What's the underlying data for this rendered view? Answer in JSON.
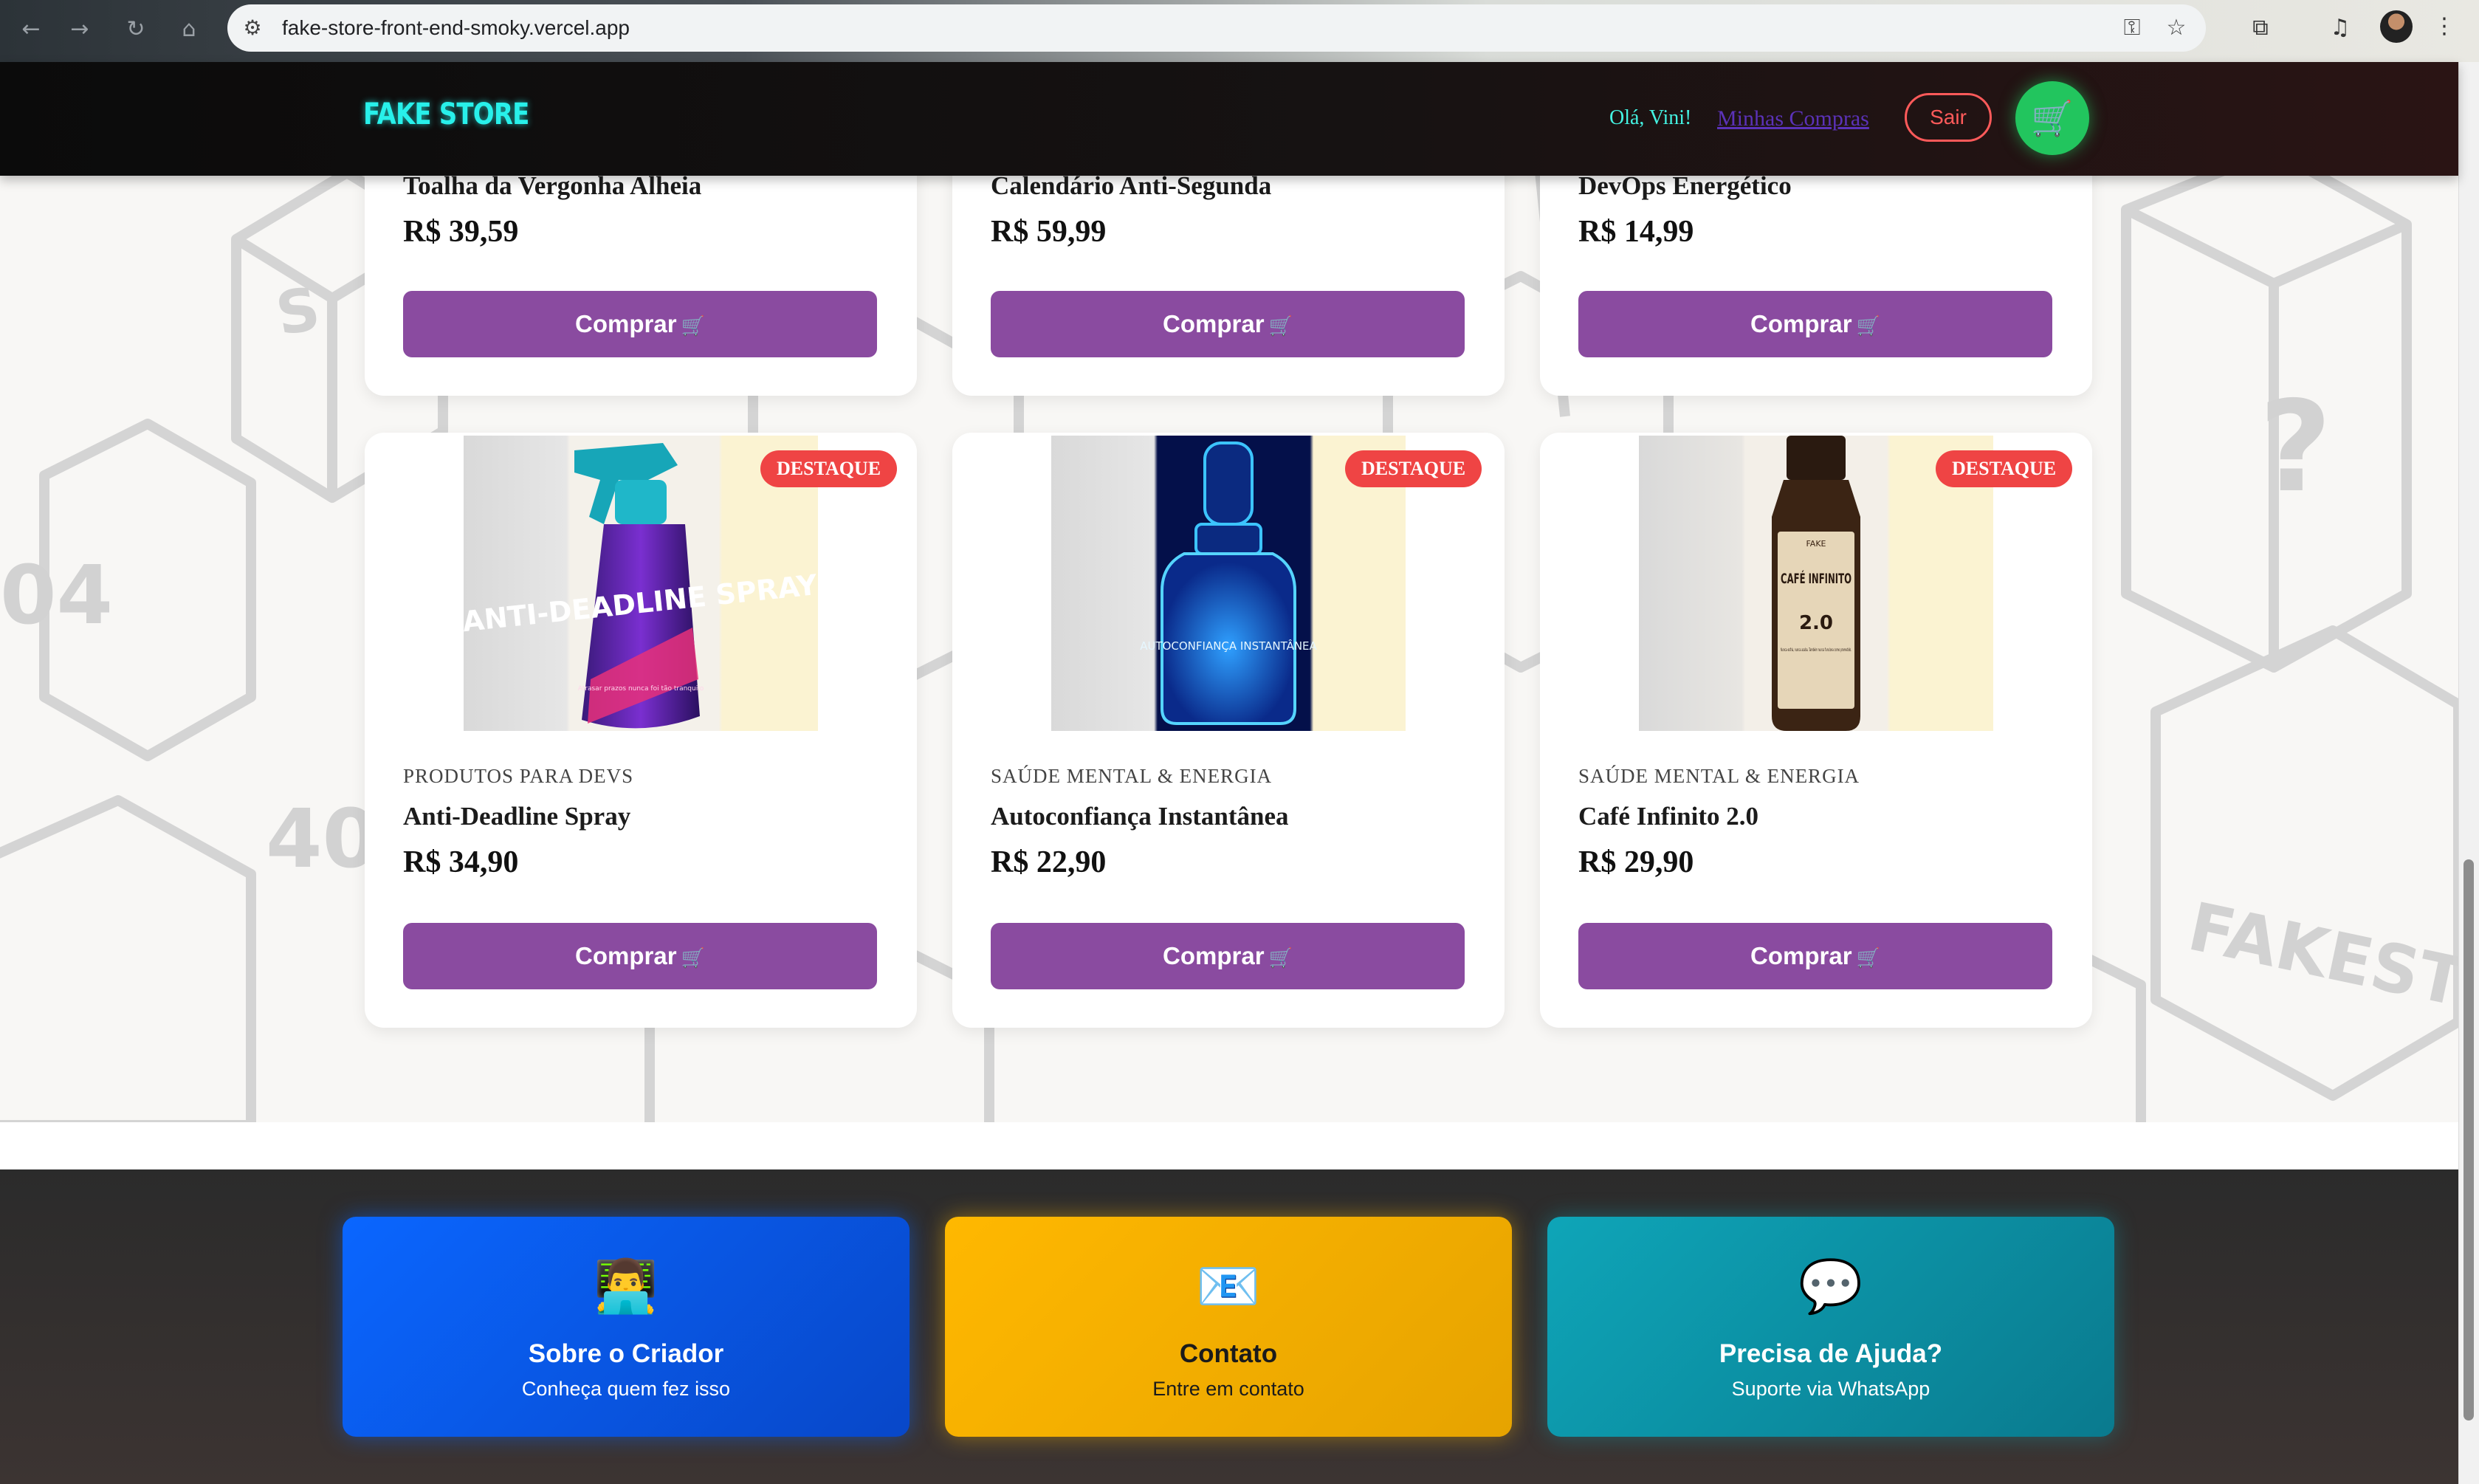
{
  "browser": {
    "url": "fake-store-front-end-smoky.vercel.app"
  },
  "header": {
    "logo": "FAKE STORE",
    "greeting": "Olá, Vini!",
    "orders_link": "Minhas Compras",
    "logout": "Sair"
  },
  "top_row": [
    {
      "name": "Toalha da Vergonha Alheia",
      "price": "R$ 39,59",
      "button": "Comprar"
    },
    {
      "name": "Calendário Anti-Segunda",
      "price": "R$ 59,99",
      "button": "Comprar"
    },
    {
      "name": "DevOps Energético",
      "price": "R$ 14,99",
      "button": "Comprar"
    }
  ],
  "products": [
    {
      "badge": "DESTAQUE",
      "category": "PRODUTOS PARA DEVS",
      "name": "Anti-Deadline Spray",
      "price": "R$ 34,90",
      "button": "Comprar",
      "label": "ANTI-DEADLINE SPRAY",
      "label_small": "Atrasar prazos nunca foi tão tranquilo"
    },
    {
      "badge": "DESTAQUE",
      "category": "SAÚDE MENTAL & ENERGIA",
      "name": "Autoconfiança Instantânea",
      "price": "R$ 22,90",
      "button": "Comprar",
      "label": "AUTOCONFIANÇA INSTANTÂNEA"
    },
    {
      "badge": "DESTAQUE",
      "category": "SAÚDE MENTAL & ENERGIA",
      "name": "Café Infinito 2.0",
      "price": "R$ 29,90",
      "button": "Comprar",
      "label_brand": "FAKE",
      "label": "CAFÉ INFINITO",
      "label_version": "2.0",
      "label_small": "Nunca esfria, nunca acaba. Também nunca funciona como prometido."
    }
  ],
  "footer": [
    {
      "icon": "👨‍💻",
      "title": "Sobre o Criador",
      "subtitle": "Conheça quem fez isso"
    },
    {
      "icon": "📧",
      "title": "Contato",
      "subtitle": "Entre em contato"
    },
    {
      "icon": "💬",
      "title": "Precisa de Ajuda?",
      "subtitle": "Suporte via WhatsApp"
    }
  ],
  "colors": {
    "accent_cyan": "#28f0ea",
    "buy_button": "#8a4ba0",
    "badge": "#ef4444",
    "cart": "#22c55e",
    "footer_blue": "#0d5be0",
    "footer_yellow": "#f5b400",
    "footer_teal": "#0e8ea0"
  }
}
